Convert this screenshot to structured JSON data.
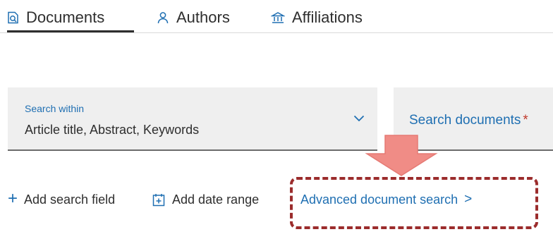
{
  "tabs": [
    {
      "label": "Documents",
      "icon": "document-search-icon",
      "active": true
    },
    {
      "label": "Authors",
      "icon": "person-icon",
      "active": false
    },
    {
      "label": "Affiliations",
      "icon": "institution-icon",
      "active": false
    }
  ],
  "search_within": {
    "label": "Search within",
    "value": "Article title, Abstract, Keywords",
    "icon": "chevron-down-icon"
  },
  "search_documents": {
    "placeholder": "Search documents",
    "required_marker": "*"
  },
  "actions": {
    "add_search_field": "Add search field",
    "add_date_range": "Add date range",
    "advanced_search": "Advanced document search",
    "advanced_search_chevron": ">"
  },
  "annotation": {
    "arrow_color": "#f08c86",
    "box_color": "#9b2c2c"
  },
  "colors": {
    "accent": "#1f6fb2",
    "required": "#c0392b",
    "field_bg": "#efefef",
    "text": "#2e2e2e"
  }
}
